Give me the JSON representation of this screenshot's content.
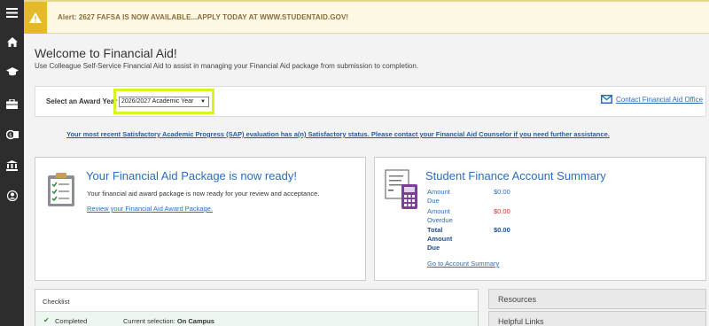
{
  "alert": {
    "text": "Alert: 2627 FAFSA IS NOW AVAILABLE...APPLY TODAY AT WWW.STUDENTAID.GOV!"
  },
  "sidebar": {
    "icons": [
      "menu-icon",
      "home-icon",
      "graduation-cap-icon",
      "briefcase-icon",
      "finance-icon",
      "bank-icon",
      "user-icon"
    ]
  },
  "welcome": {
    "title": "Welcome to Financial Aid!",
    "subtitle": "Use Colleague Self-Service Financial Aid to assist in managing your Financial Aid package from submission to completion."
  },
  "award_year": {
    "label": "Select an Award Year",
    "selected": "2026/2027 Academic Year",
    "contact_link": "Contact Financial Aid Office"
  },
  "sap_message": "Your most recent Satisfactory Academic Progress (SAP) evaluation has a(n) Satisfactory status. Please contact your Financial Aid Counselor if you need further assistance.",
  "aid_package": {
    "title": "Your Financial Aid Package is now ready!",
    "description": "Your financial aid award package is now ready for your review and acceptance.",
    "link": "Review your Financial Aid Award Package."
  },
  "finance_summary": {
    "title": "Student Finance Account Summary",
    "rows": [
      {
        "label_lines": [
          "Amount",
          "Due"
        ],
        "value": "$0.00",
        "value_color": "#2a6dbf",
        "bold": false
      },
      {
        "label_lines": [
          "Amount",
          "Overdue"
        ],
        "value": "$0.00",
        "value_color": "#d0312d",
        "bold": false
      },
      {
        "label_lines": [
          "Total",
          "Amount",
          "Due"
        ],
        "value": "$0.00",
        "value_color": "#1f4f8a",
        "bold": true
      }
    ],
    "link": "Go to Account Summary"
  },
  "checklist": {
    "header": "Checklist",
    "status": "Completed",
    "selection_label": "Current selection:",
    "selection_value": "On Campus"
  },
  "panels": {
    "resources": "Resources",
    "helpful_links": "Helpful Links"
  },
  "colors": {
    "accent": "#2a6dbf",
    "highlight": "#d9f125",
    "alert_bg": "#fcf8e3",
    "sidebar": "#2d2d2d"
  }
}
